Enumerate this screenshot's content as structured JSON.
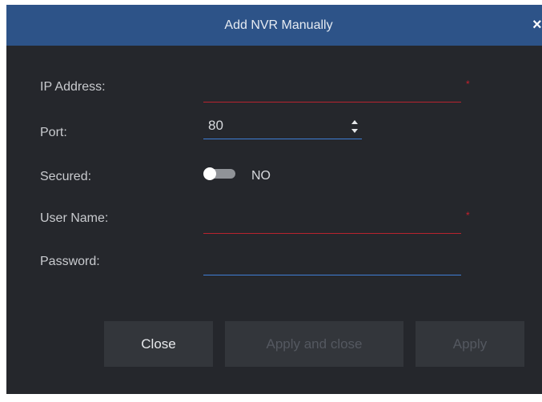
{
  "dialog": {
    "title": "Add NVR Manually",
    "close_glyph": "×"
  },
  "form": {
    "ip_address": {
      "label": "IP Address:",
      "value": "",
      "required_mark": "*"
    },
    "port": {
      "label": "Port:",
      "value": "80"
    },
    "secured": {
      "label": "Secured:",
      "state": "NO"
    },
    "user_name": {
      "label": "User Name:",
      "value": "",
      "required_mark": "*"
    },
    "password": {
      "label": "Password:",
      "value": ""
    }
  },
  "buttons": {
    "close": "Close",
    "apply_and_close": "Apply and close",
    "apply": "Apply"
  },
  "colors": {
    "title_bar": "#2d5388",
    "dialog_bg": "#25272c",
    "required_underline": "#b8232f",
    "normal_underline": "#3f7ed6"
  },
  "icons": {
    "close": "close-icon",
    "stepper": "spinner-arrows-icon",
    "toggle": "toggle-switch"
  }
}
